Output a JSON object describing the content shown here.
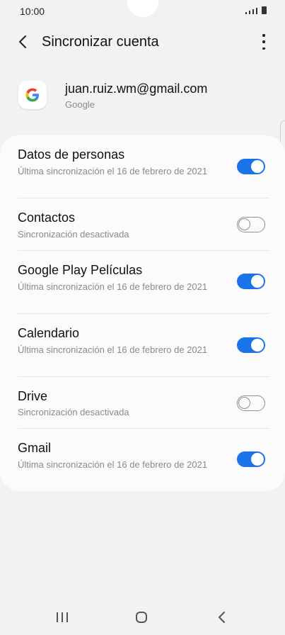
{
  "status_bar": {
    "time": "10:00"
  },
  "app_bar": {
    "title": "Sincronizar cuenta"
  },
  "account": {
    "email": "juan.ruiz.wm@gmail.com",
    "provider": "Google"
  },
  "sync_items": [
    {
      "label": "Datos de personas",
      "status": "Última sincronización el 16 de febrero de 2021",
      "enabled": true
    },
    {
      "label": "Contactos",
      "status": "Sincronización desactivada",
      "enabled": false
    },
    {
      "label": "Google Play Películas",
      "status": "Última sincronización el 16 de febrero de 2021",
      "enabled": true
    },
    {
      "label": "Calendario",
      "status": "Última sincronización el 16 de febrero de 2021",
      "enabled": true
    },
    {
      "label": "Drive",
      "status": "Sincronización desactivada",
      "enabled": false
    },
    {
      "label": "Gmail",
      "status": "Última sincronización el 16 de febrero de 2021",
      "enabled": true
    }
  ],
  "colors": {
    "toggle_on": "#1a73e8",
    "background": "#f2f2f2",
    "card": "#fbfbfb"
  }
}
